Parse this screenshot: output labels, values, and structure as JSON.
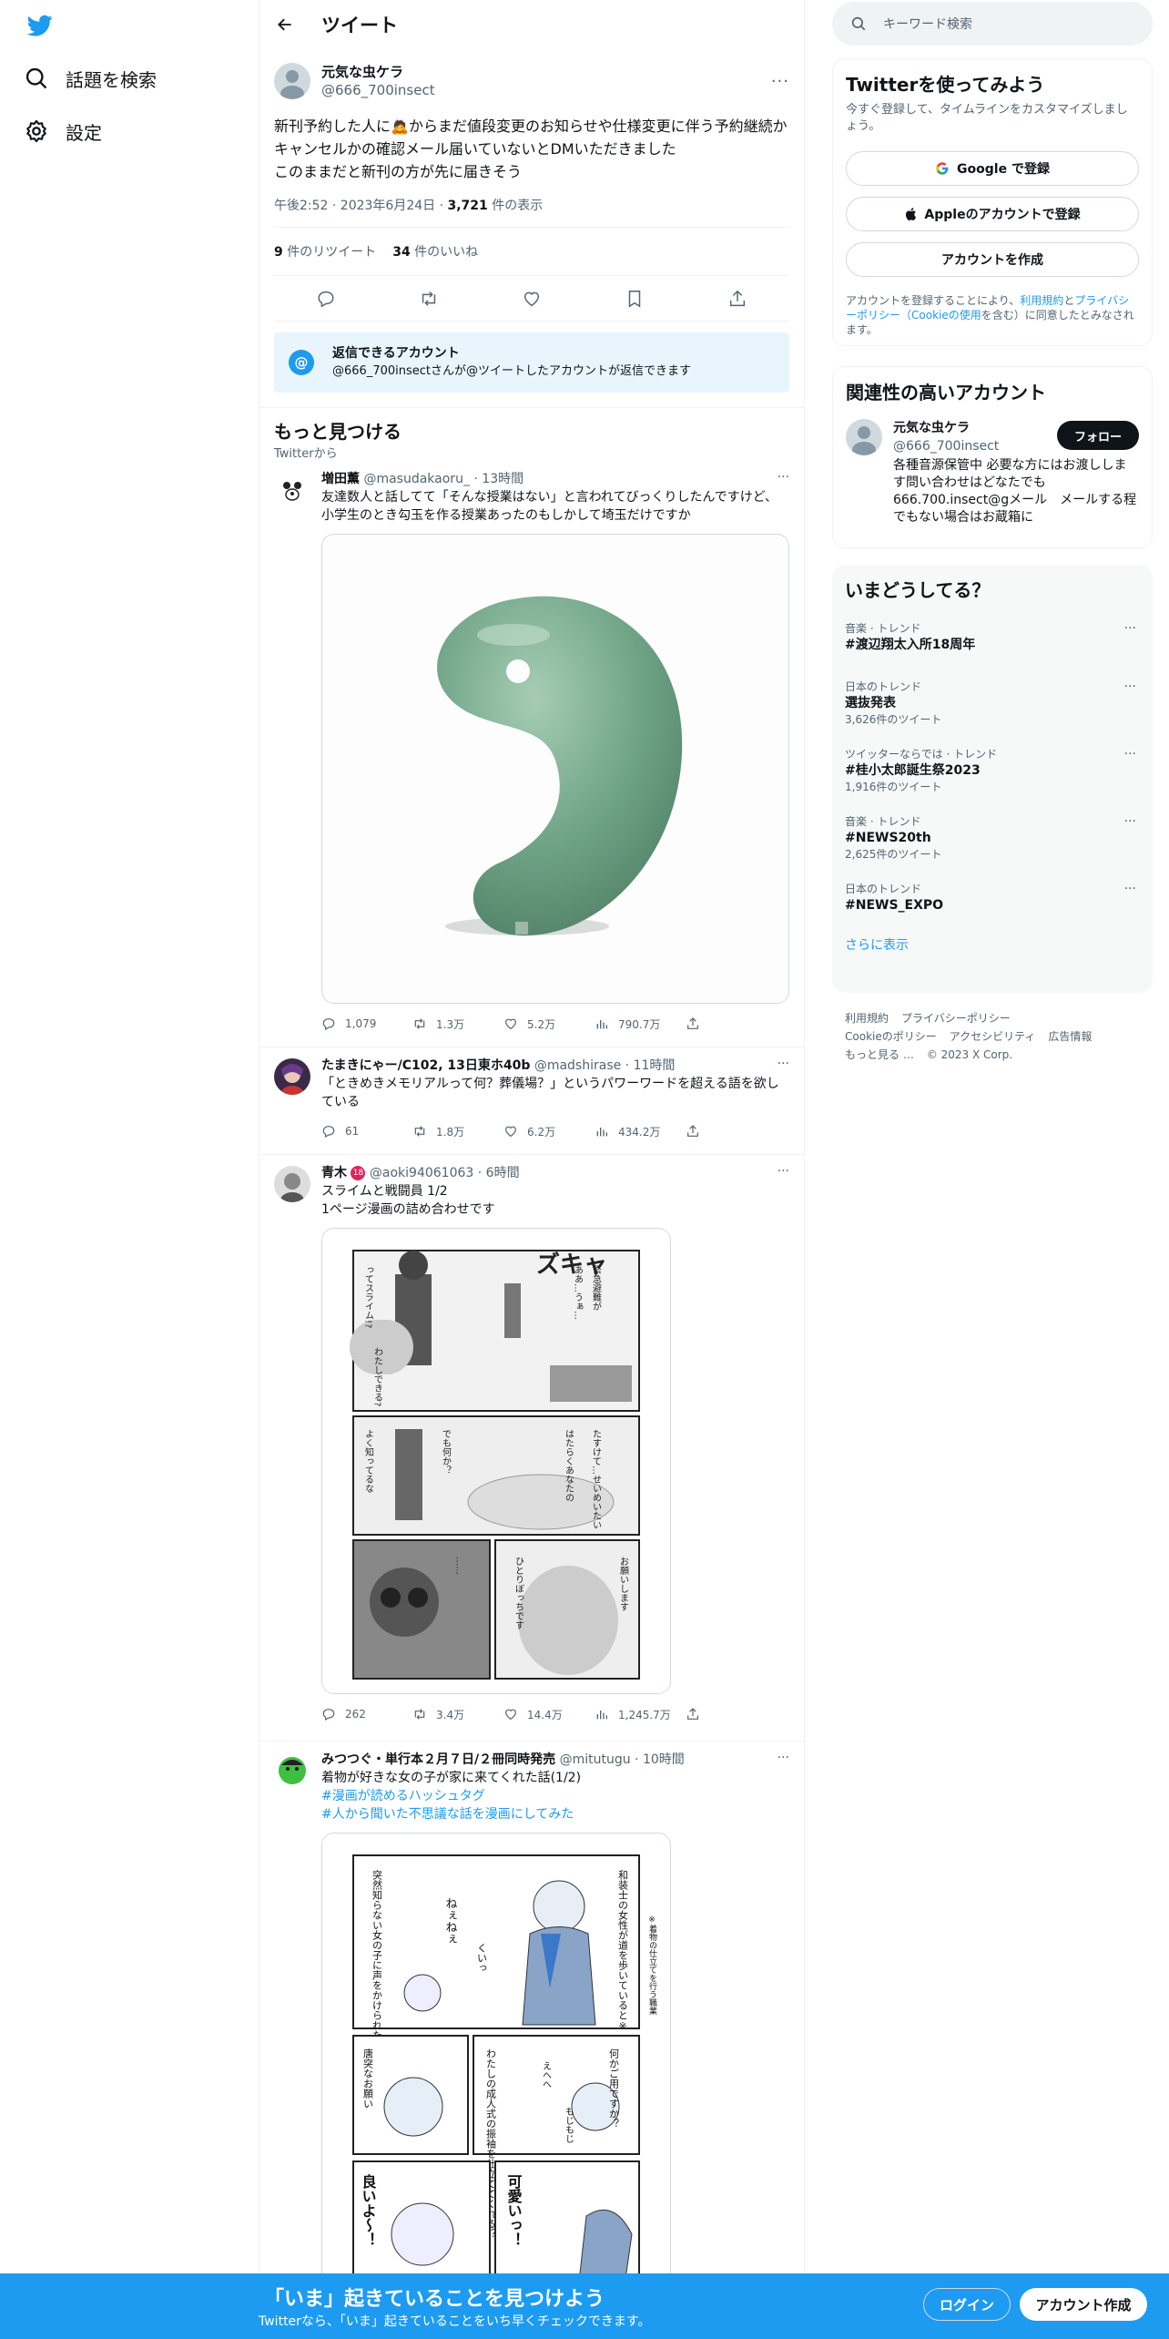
{
  "nav": {
    "explore_label": "話題を検索",
    "settings_label": "設定"
  },
  "header": {
    "back_icon": "arrow-left-icon",
    "title": "ツイート"
  },
  "main_tweet": {
    "name": "元気な虫ケラ",
    "handle": "@666_700insect",
    "text_before_emoji": "新刊予約した人に",
    "emoji": "🙇",
    "text_after_emoji": "からまだ値段変更のお知らせや仕様変更に伴う予約継続かキャンセルかの確認メール届いていないとDMいただきました\nこのままだと新刊の方が先に届きそう",
    "time": "午後2:52 · 2023年6月24日 · ",
    "views_count": "3,721",
    "views_label": " 件の表示",
    "retweets_count": "9",
    "retweets_label": " 件のリツイート",
    "likes_count": "34",
    "likes_label": " 件のいいね"
  },
  "reply_notice": {
    "title": "返信できるアカウント",
    "text": "@666_700insectさんが@ツイートしたアカウントが返信できます"
  },
  "discover": {
    "title": "もっと見つける",
    "subtitle": "Twitterから"
  },
  "tweets": [
    {
      "name": "増田薫",
      "handle": "@masudakaoru_",
      "time": " · 13時間",
      "text": "友達数人と話してて「そんな授業はない」と言われてびっくりしたんですけど、小学生のとき勾玉を作る授業あったのもしかして埼玉だけですか",
      "replies": "1,079",
      "retweets": "1.3万",
      "likes": "5.2万",
      "views": "790.7万"
    },
    {
      "name": "たまきにゃー/C102, 13日東ホ40b",
      "handle": "@madshirase",
      "time": " · 11時間",
      "text": "「ときめきメモリアルって何？葬儀場？」というパワーワードを超える語を欲している",
      "replies": "61",
      "retweets": "1.8万",
      "likes": "6.2万",
      "views": "434.2万"
    },
    {
      "name": "青木",
      "badge": "18",
      "handle": "@aoki94061063",
      "time": " · 6時間",
      "text": "スライムと戦闘員 1/2\n1ページ漫画の詰め合わせです",
      "replies": "262",
      "retweets": "3.4万",
      "likes": "14.4万",
      "views": "1,245.7万"
    },
    {
      "name": "みつつぐ・単行本２月７日/２冊同時発売",
      "handle": "@mitutugu",
      "time": " · 10時間",
      "text": "着物が好きな女の子が家に来てくれた話(1/2)",
      "hashtag1": "#漫画が読めるハッシュタグ",
      "hashtag2": "#人から聞いた不思議な話を漫画にしてみた"
    }
  ],
  "manga1": {
    "sfx_top": "ズキャ",
    "bubbles": [
      "ああ…うぁ…",
      "緊急避難が",
      "ってスライム!?",
      "わたしできる?",
      "よく知ってるな",
      "でも何か？",
      "たすけて…せいめいたい",
      "はたらくあなたの",
      "……",
      "ひとりぼっちです",
      "お願いします"
    ]
  },
  "manga2": {
    "bubbles": [
      "和装士の女性が道を歩いていると※",
      "突然知らない女の子に声をかけられた",
      "ねぇねぇ",
      "くいっ",
      "※着物の仕立てを行う職業",
      "何かご用ですか？",
      "わたしの成人式の振袖を仕立ててくれる？",
      "えへへ",
      "もじもじ",
      "唐突なお願い",
      "可愛いっ！",
      "良いよ〜！"
    ]
  },
  "right": {
    "search_placeholder": "キーワード検索",
    "signup_title": "Twitterを使ってみよう",
    "signup_sub": "今すぐ登録して、タイムラインをカスタマイズしましょう。",
    "google_label": "Google で登録",
    "apple_label": "Appleのアカウントで登録",
    "create_label": "アカウントを作成",
    "legal_pre": "アカウントを登録することにより、",
    "legal_terms": "利用規約",
    "legal_and": "と",
    "legal_privacy": "プライバシーポリシー",
    "legal_cookie": "（Cookieの使用",
    "legal_post": "を含む）に同意したとみなされます。",
    "related_title": "関連性の高いアカウント",
    "related_name": "元気な虫ケラ",
    "related_handle": "@666_700insect",
    "related_bio": "各種音源保管中 必要な方にはお渡しします問い合わせはどなたでも 666.700.insect@gメール　メールする程でもない場合はお蔵箱に",
    "follow_label": "フォロー",
    "trends_title": "いまどうしてる？",
    "trends": [
      {
        "context": "音楽 · トレンド",
        "name": "#渡辺翔太入所18周年",
        "count": ""
      },
      {
        "context": "日本のトレンド",
        "name": "選抜発表",
        "count": "3,626件のツイート"
      },
      {
        "context": "ツイッターならでは · トレンド",
        "name": "#桂小太郎誕生祭2023",
        "count": "1,916件のツイート"
      },
      {
        "context": "音楽 · トレンド",
        "name": "#NEWS20th",
        "count": "2,625件のツイート"
      },
      {
        "context": "日本のトレンド",
        "name": "#NEWS_EXPO",
        "count": ""
      }
    ],
    "show_more": "さらに表示",
    "footer": [
      "利用規約",
      "プライバシーポリシー",
      "Cookieのポリシー",
      "アクセシビリティ",
      "広告情報",
      "もっと見る …",
      "© 2023 X Corp."
    ]
  },
  "bottom": {
    "title": "「いま」起きていることを見つけよう",
    "subtitle": "Twitterなら、「いま」起きていることをいち早くチェックできます。",
    "login": "ログイン",
    "signup": "アカウント作成"
  },
  "colors": {
    "accent": "#1d9bf0",
    "text": "#0f1419",
    "muted": "#536471"
  }
}
